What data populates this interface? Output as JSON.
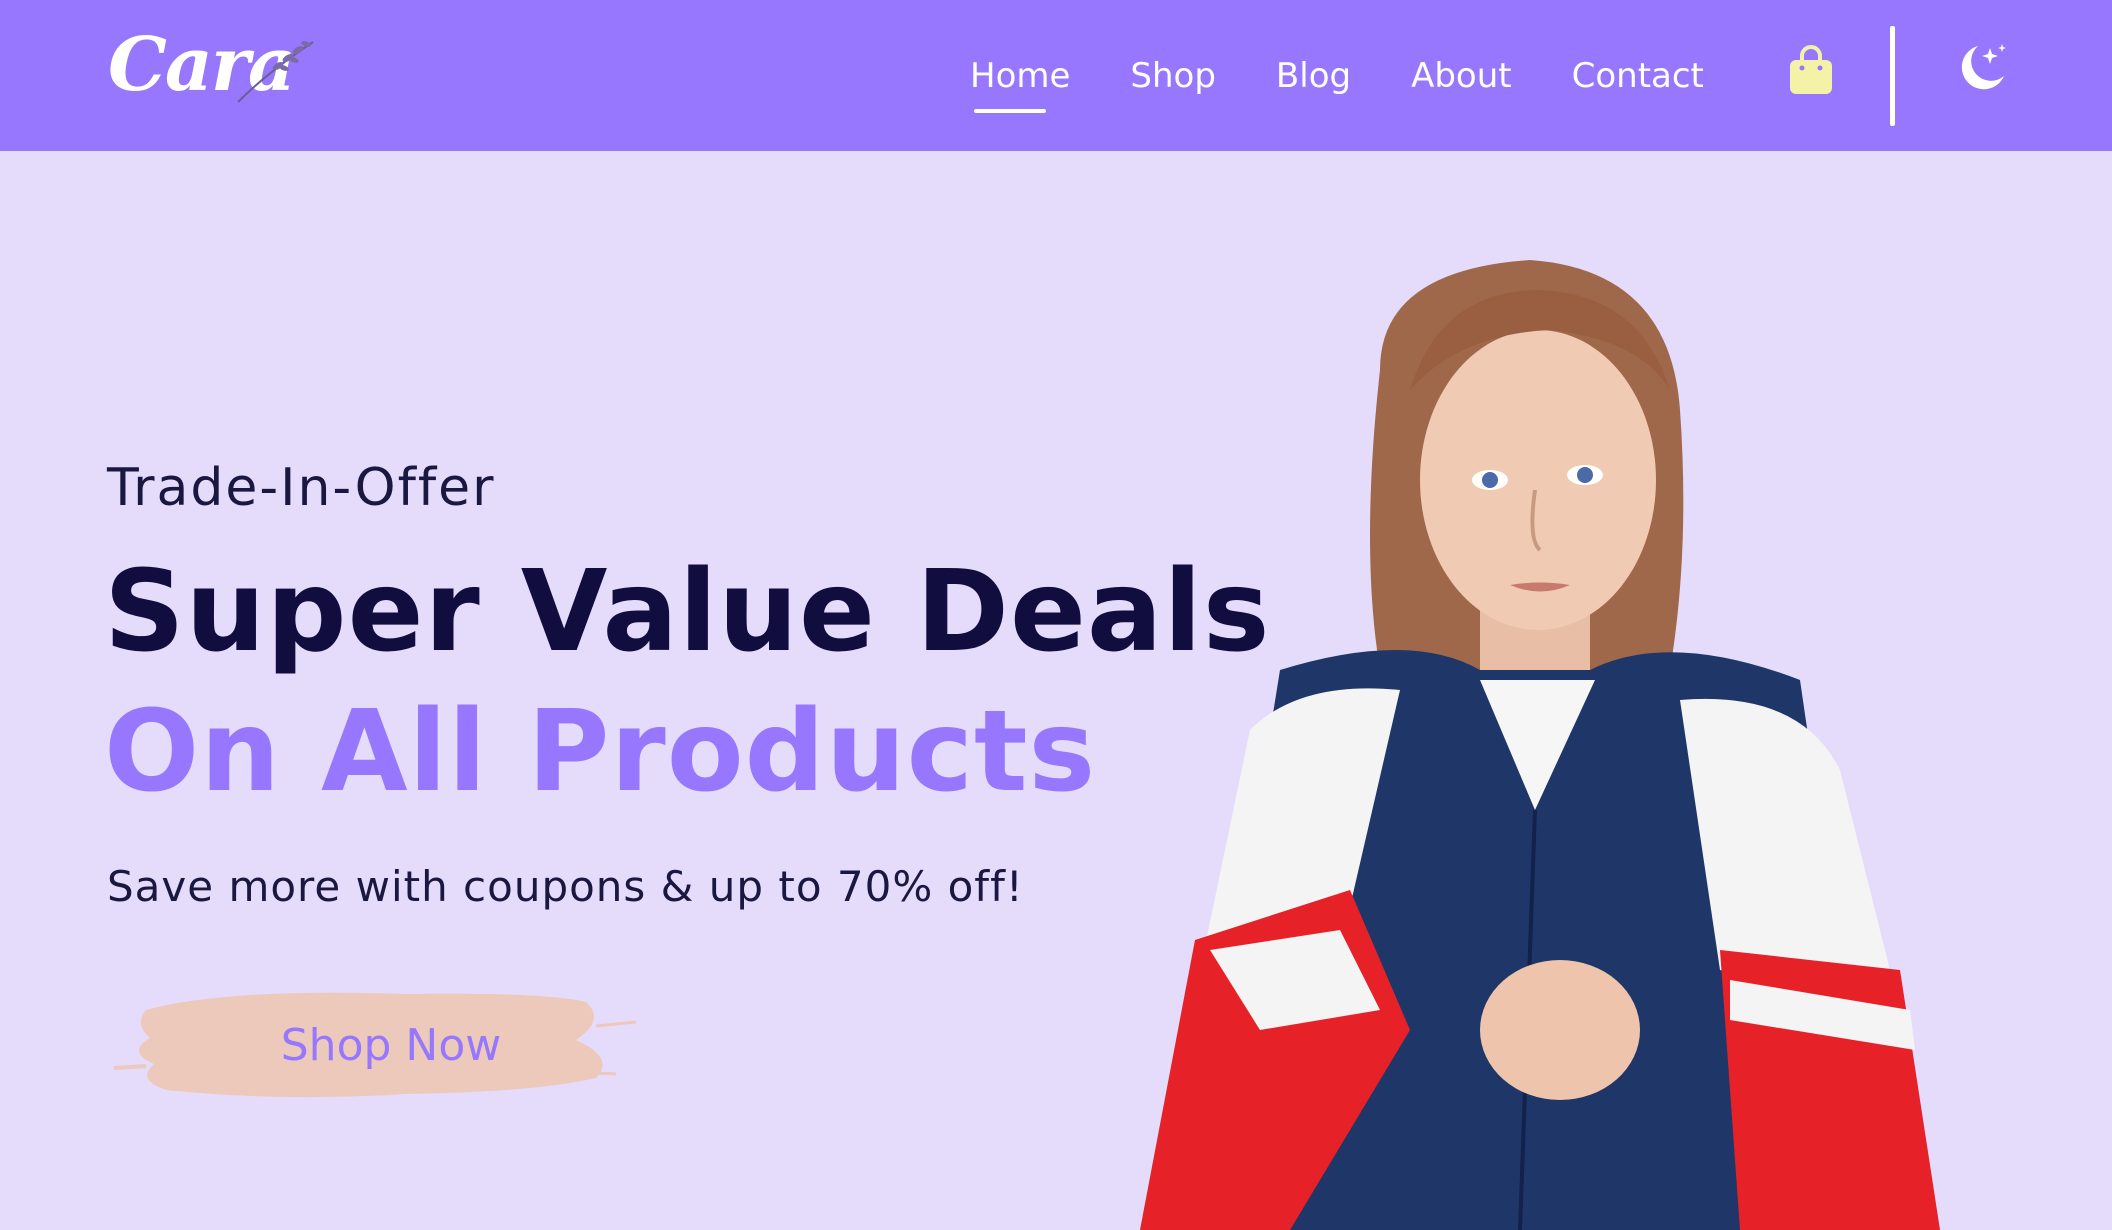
{
  "brand": {
    "logo_text": "Cara"
  },
  "nav": {
    "items": [
      {
        "label": "Home",
        "active": true
      },
      {
        "label": "Shop",
        "active": false
      },
      {
        "label": "Blog",
        "active": false
      },
      {
        "label": "About",
        "active": false
      },
      {
        "label": "Contact",
        "active": false
      }
    ],
    "cart_icon": "shopping-bag-icon",
    "theme_icon": "moon-stars-icon"
  },
  "hero": {
    "subtitle": "Trade-In-Offer",
    "title": "Super Value Deals",
    "highlight": "On All Products",
    "description": "Save more with coupons & up to 70% off!",
    "cta_label": "Shop Now",
    "image_icon": "model-photo"
  },
  "colors": {
    "header_bg": "#9677fe",
    "page_bg": "#e5dcfb",
    "accent": "#9677fe",
    "heading": "#120d3f",
    "cta_brush": "#ecc9bb",
    "cart_icon": "#f3f2a6"
  }
}
